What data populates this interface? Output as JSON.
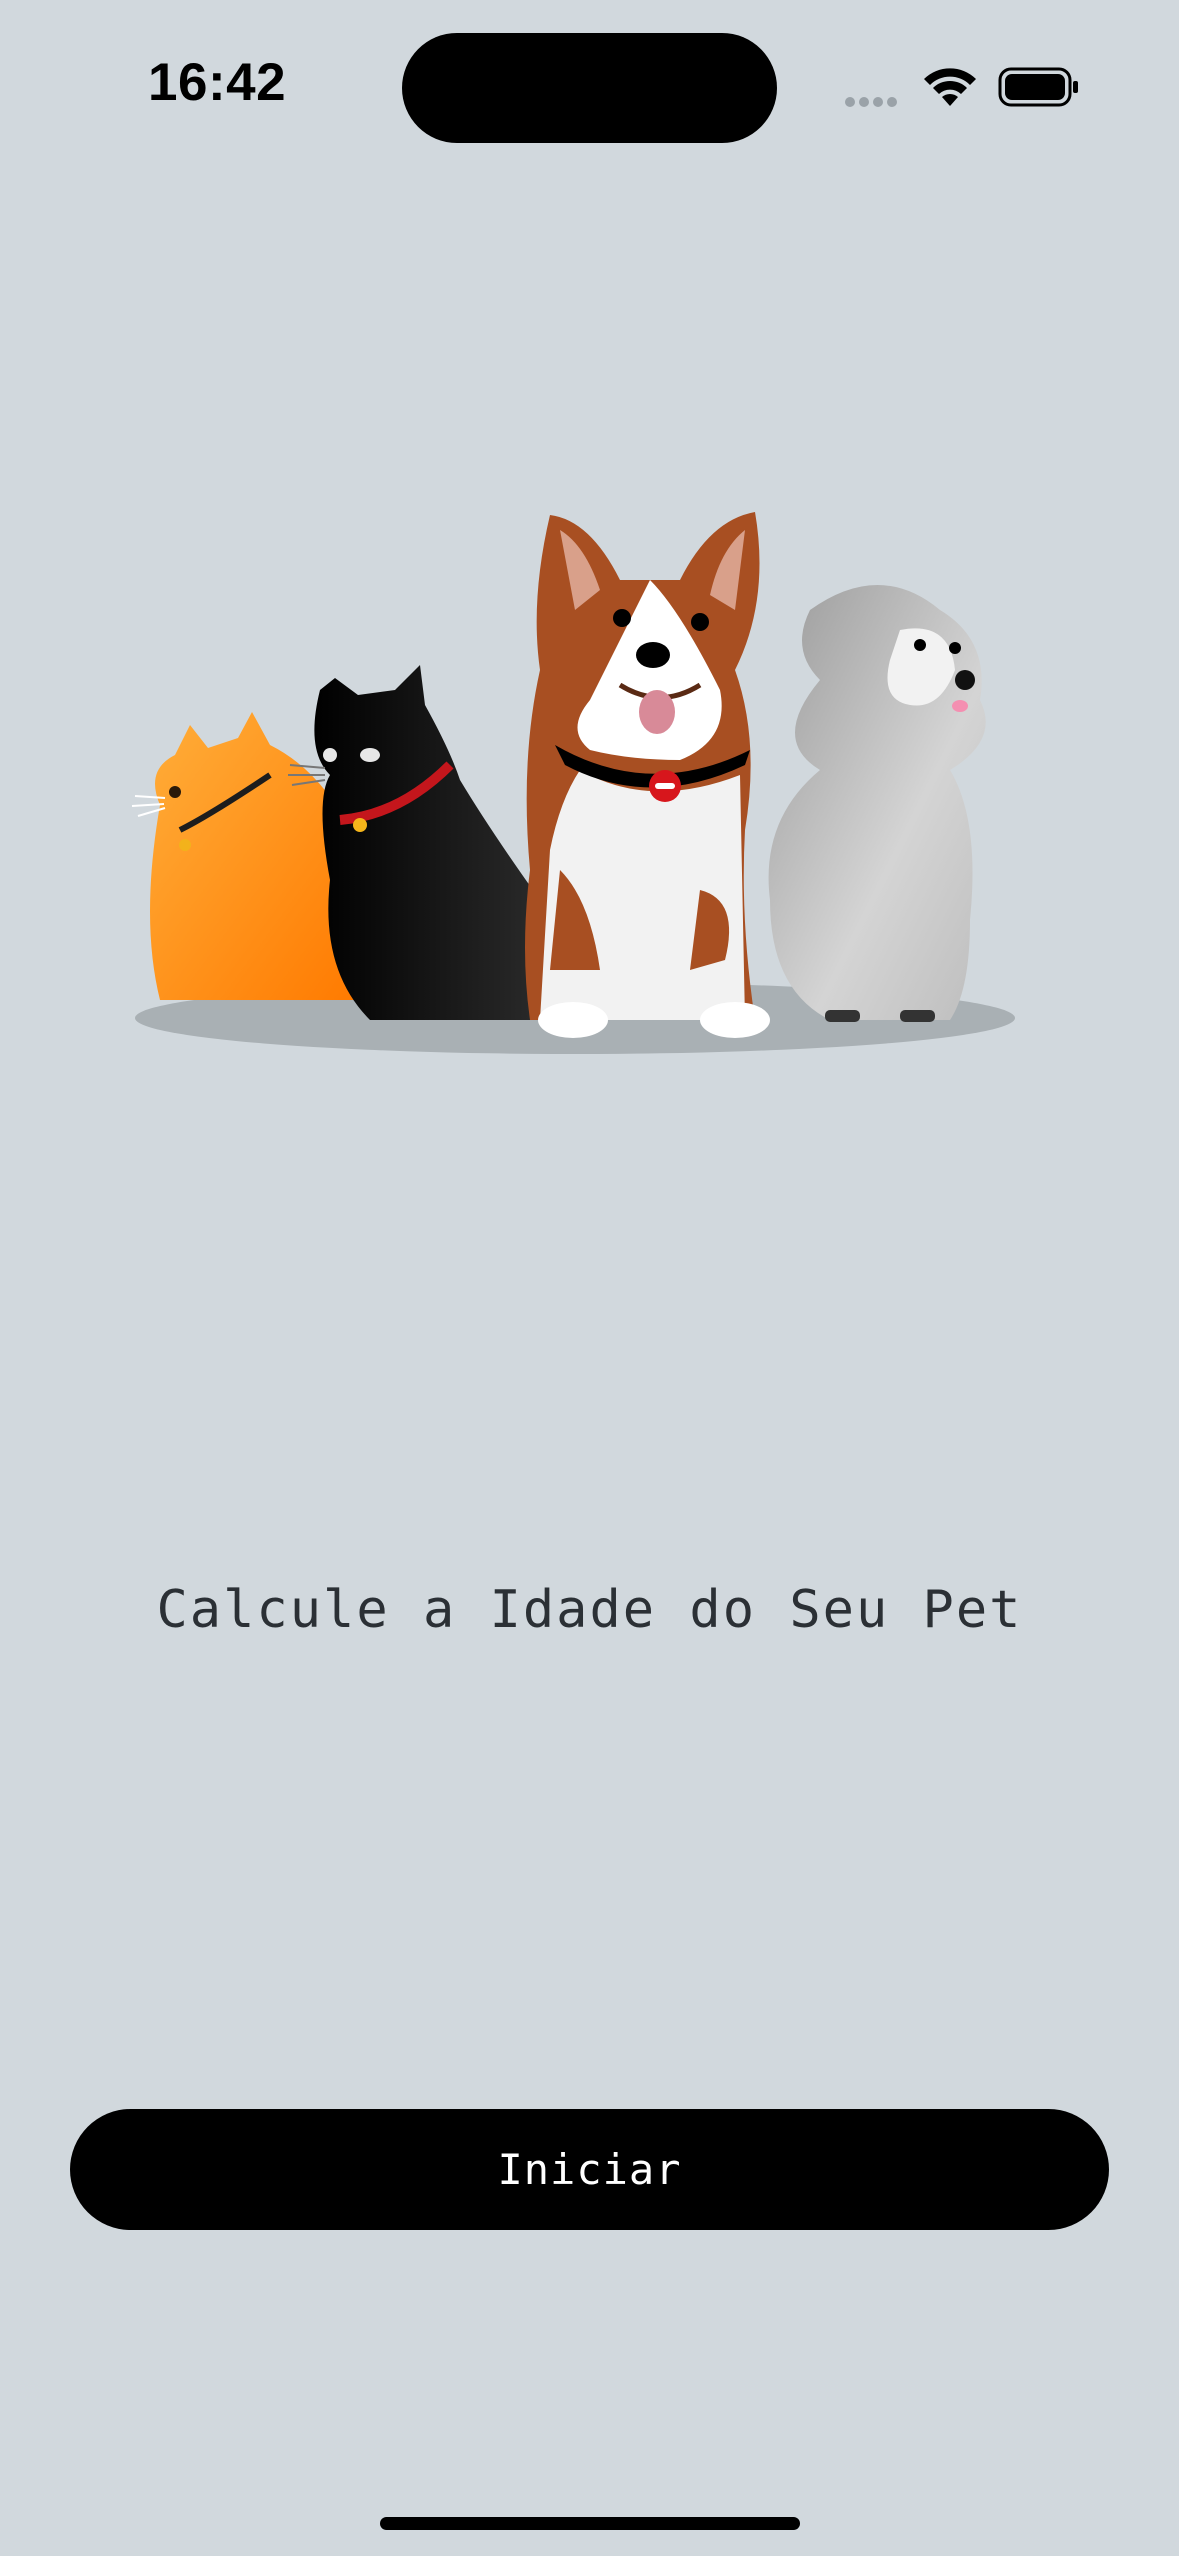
{
  "status_bar": {
    "time": "16:42",
    "icons": [
      "cellular-signal-icon",
      "wifi-icon",
      "battery-icon"
    ]
  },
  "hero": {
    "illustration": "pets-group-illustration",
    "pets": [
      "orange-cat",
      "black-cat",
      "corgi-dog",
      "gray-poodle"
    ]
  },
  "main": {
    "title": "Calcule a Idade do Seu Pet"
  },
  "actions": {
    "start_label": "Iniciar"
  },
  "colors": {
    "background": "#d1d8dd",
    "button": "#000000",
    "button_text": "#ffffff",
    "title_text": "#2b3035"
  }
}
